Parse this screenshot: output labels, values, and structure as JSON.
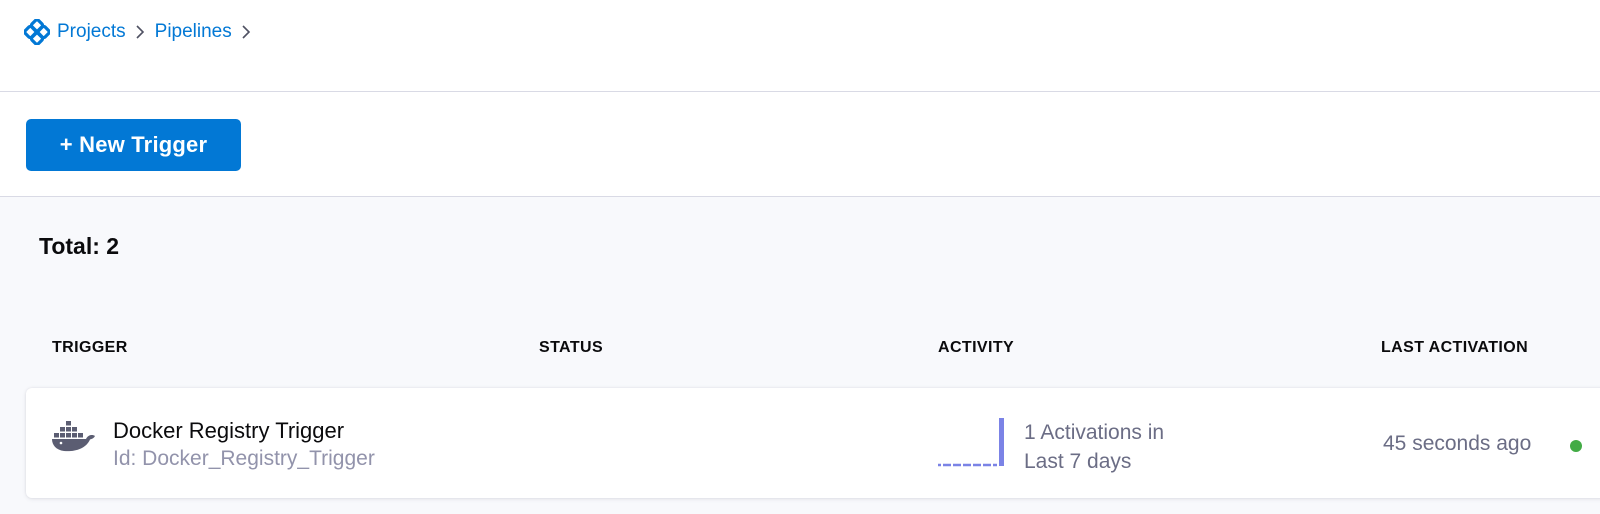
{
  "breadcrumb": {
    "items": [
      {
        "label": "Projects"
      },
      {
        "label": "Pipelines"
      }
    ]
  },
  "toolbar": {
    "new_trigger_label": "+ New Trigger"
  },
  "summary": {
    "total_label": "Total: 2"
  },
  "table": {
    "headers": {
      "trigger": "TRIGGER",
      "status": "STATUS",
      "activity": "ACTIVITY",
      "last_activation": "LAST ACTIVATION"
    },
    "rows": [
      {
        "icon": "docker-icon",
        "name": "Docker Registry Trigger",
        "id_label": "Id: Docker_Registry_Trigger",
        "status": "",
        "activity_line1": "1 Activations in",
        "activity_line2": "Last 7 days",
        "activity_daily_counts": [
          0,
          0,
          0,
          0,
          0,
          0,
          1
        ],
        "last_activation": "45 seconds ago",
        "last_activation_status_color": "#42ab45"
      }
    ]
  },
  "colors": {
    "accent": "#0278d5",
    "activity_bar": "#7b83e6",
    "success": "#42ab45"
  }
}
